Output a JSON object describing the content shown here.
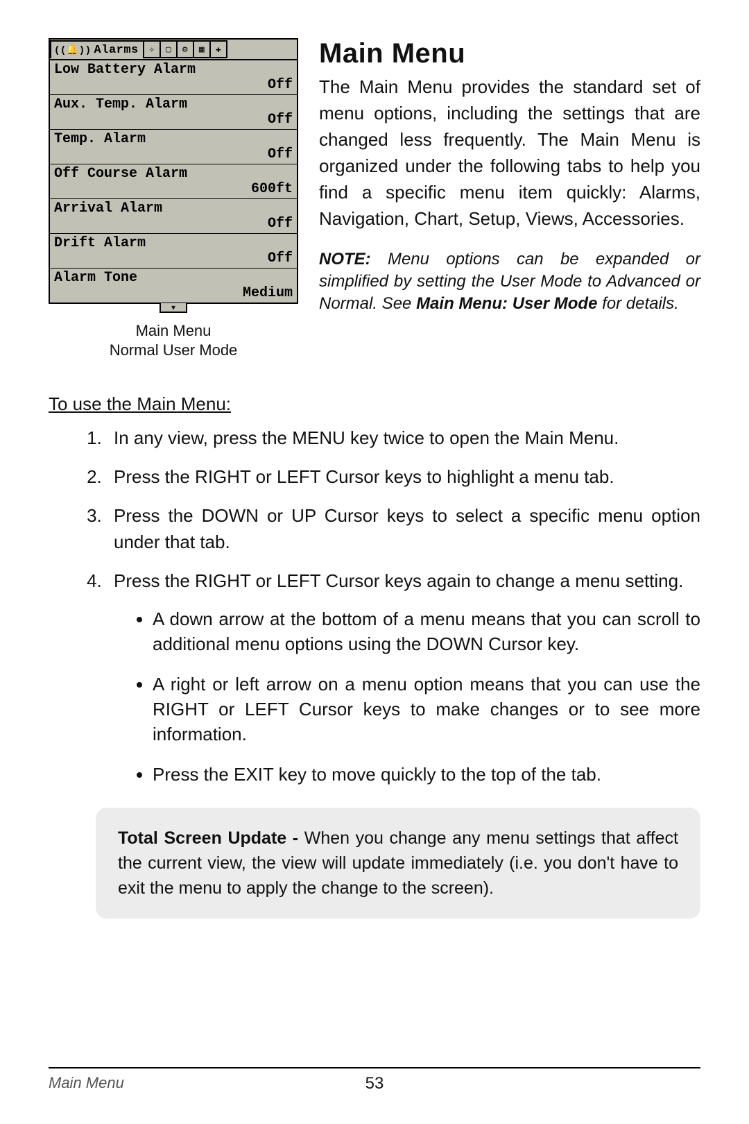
{
  "screenshot": {
    "active_tab_label": "Alarms",
    "items": [
      {
        "label": "Low Battery Alarm",
        "value": "Off"
      },
      {
        "label": "Aux. Temp. Alarm",
        "value": "Off"
      },
      {
        "label": "Temp. Alarm",
        "value": "Off"
      },
      {
        "label": "Off Course Alarm",
        "value": "600ft"
      },
      {
        "label": "Arrival Alarm",
        "value": "Off"
      },
      {
        "label": "Drift Alarm",
        "value": "Off"
      },
      {
        "label": "Alarm Tone",
        "value": "Medium"
      }
    ],
    "caption_line1": "Main Menu",
    "caption_line2": "Normal User Mode"
  },
  "heading": "Main Menu",
  "intro_paragraph": "The Main Menu provides the standard set of menu options, including the settings that are changed less frequently. The Main Menu is organized under the following tabs to help you find a specific menu item quickly: Alarms, Navigation, Chart, Setup, Views, Accessories.",
  "note": {
    "lead": "NOTE:",
    "body_before_ref": " Menu options can be expanded or simplified by setting the User Mode to Advanced or Normal. See ",
    "ref_title": "Main Menu: User Mode",
    "body_after_ref": " for details."
  },
  "howto_title": "To use the Main Menu:",
  "steps": [
    "In any view, press the MENU key twice to open the Main Menu.",
    "Press the RIGHT or LEFT Cursor keys to highlight a menu tab.",
    "Press the DOWN or UP Cursor keys to select a specific menu option under that tab.",
    "Press the RIGHT or LEFT Cursor keys again to change a menu setting."
  ],
  "sub_bullets": [
    "A down arrow at the bottom of a menu means that you can scroll to additional menu options using the DOWN Cursor key.",
    "A right or left arrow on a menu option means that you can use the RIGHT or LEFT Cursor keys to make changes or to see more information.",
    "Press the EXIT key to move quickly to the top of the tab."
  ],
  "callout": {
    "lead": "Total Screen Update - ",
    "body": "When you change any menu settings that affect the current view, the view will update immediately (i.e. you don't have to exit the menu to apply the change to the screen)."
  },
  "footer": {
    "section": "Main Menu",
    "page": "53"
  }
}
